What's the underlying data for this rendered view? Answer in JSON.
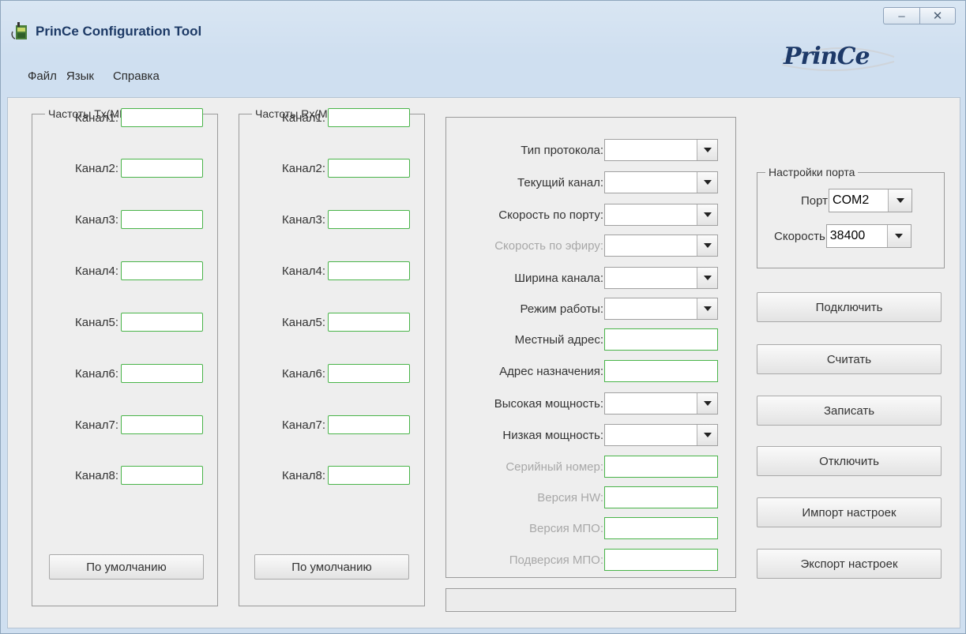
{
  "window": {
    "title": "PrinCe Configuration Tool",
    "minimize_glyph": "–",
    "close_glyph": "✕"
  },
  "menu": [
    "Файл",
    "Язык",
    "Справка"
  ],
  "tx_group": {
    "title": "Частоты Tx(МГц)",
    "channels": [
      "Канал1:",
      "Канал2:",
      "Канал3:",
      "Канал4:",
      "Канал5:",
      "Канал6:",
      "Канал7:",
      "Канал8:"
    ],
    "default_button": "По умолчанию"
  },
  "rx_group": {
    "title": "Частоты Rx(МГц)",
    "channels": [
      "Канал1:",
      "Канал2:",
      "Канал3:",
      "Канал4:",
      "Канал5:",
      "Канал6:",
      "Канал7:",
      "Канал8:"
    ],
    "default_button": "По умолчанию"
  },
  "settings": {
    "protocol_type": "Тип протокола:",
    "current_channel": "Текущий канал:",
    "port_speed": "Скорость по порту:",
    "air_speed": "Скорость по эфиру:",
    "channel_width": "Ширина канала:",
    "work_mode": "Режим работы:",
    "local_address": "Местный адрес:",
    "destination_address": "Адрес назначения:",
    "high_power": "Высокая мощность:",
    "low_power": "Низкая мощность:",
    "serial_number": "Серийный номер:",
    "hw_version": "Версия HW:",
    "sw_version": "Версия МПО:",
    "sw_subversion": "Подверсия МПО:"
  },
  "logo": {
    "text": "PrinCe"
  },
  "port_settings": {
    "title": "Настройки порта",
    "port_label": "Порт",
    "port_value": "COM2",
    "speed_label": "Скорость",
    "speed_value": "38400"
  },
  "actions": {
    "connect": "Подключить",
    "read": "Считать",
    "write": "Записать",
    "disconnect": "Отключить",
    "import": "Импорт настроек",
    "export": "Экспорт настроек"
  },
  "colors": {
    "title_text": "#1d3a66",
    "field_border": "#49b449",
    "disabled_label": "#a8a8a8"
  }
}
